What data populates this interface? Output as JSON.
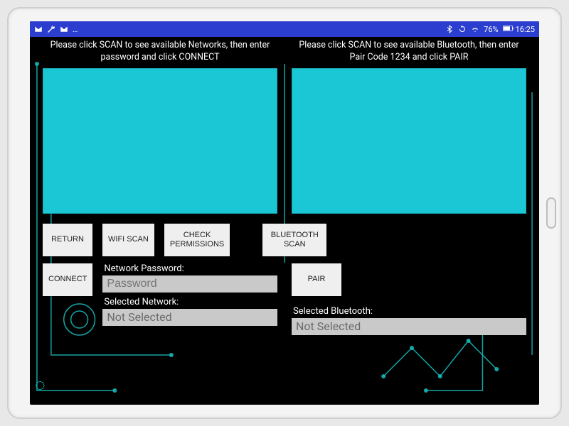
{
  "status_bar": {
    "left_icons": [
      "mail-icon",
      "wrench-icon",
      "mail-icon"
    ],
    "left_ellipsis": "…",
    "right_icons": [
      "bluetooth-icon",
      "sync-icon",
      "wifi-icon"
    ],
    "battery_text": "76%",
    "time": "16:25"
  },
  "instructions": {
    "wifi": "Please click SCAN to see available Networks, then enter password and click CONNECT",
    "bluetooth": "Please click SCAN to see available Bluetooth, then enter Pair Code 1234 and click PAIR"
  },
  "buttons": {
    "return": "RETURN",
    "wifi_scan": "WIFI SCAN",
    "check_permissions": "CHECK\nPERMISSIONS",
    "bluetooth_scan": "BLUETOOTH\nSCAN",
    "connect": "CONNECT",
    "pair": "PAIR"
  },
  "wifi": {
    "password_label": "Network Password:",
    "password_placeholder": "Password",
    "password_value": "",
    "selected_label": "Selected Network:",
    "selected_value": "Not Selected"
  },
  "bluetooth": {
    "selected_label": "Selected Bluetooth:",
    "selected_value": "Not Selected"
  }
}
